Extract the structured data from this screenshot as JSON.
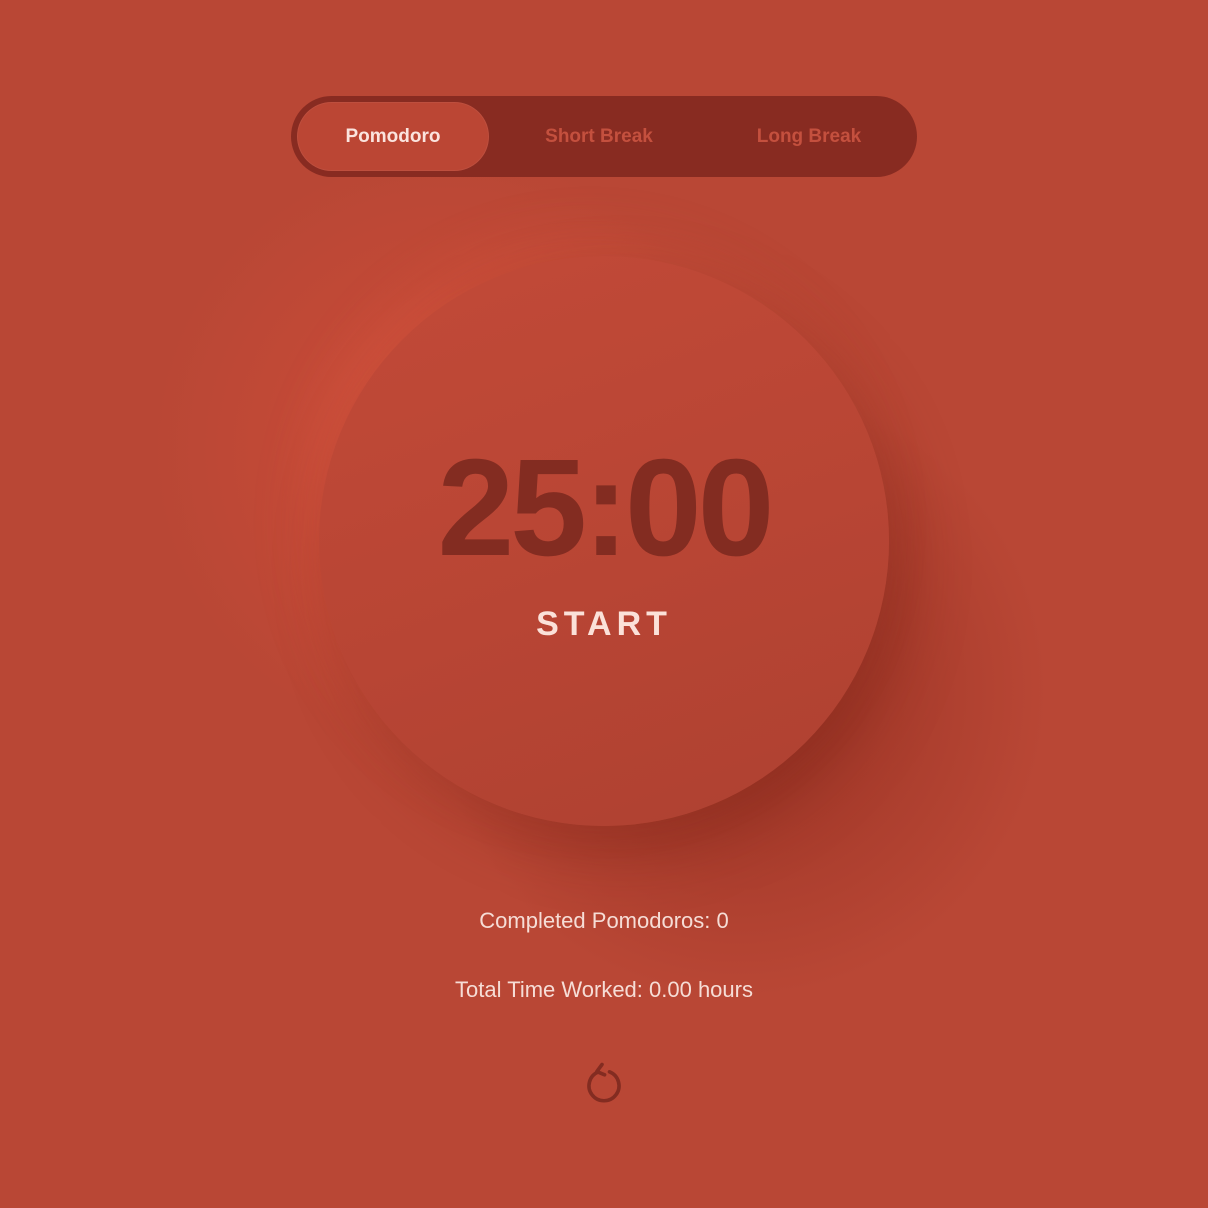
{
  "modes": {
    "pomodoro": "Pomodoro",
    "short_break": "Short Break",
    "long_break": "Long Break",
    "active": "Pomodoro"
  },
  "timer": {
    "display": "25:00",
    "action_label": "START"
  },
  "stats": {
    "completed": "Completed Pomodoros: 0",
    "total_time": "Total Time Worked: 0.00 hours"
  },
  "icons": {
    "reset": "reset-icon"
  },
  "colors": {
    "background": "#b94735",
    "switch_track": "#882b21",
    "active_tab": "#bb4634",
    "timer_text": "#832c21",
    "light_text": "#fbe1d9"
  }
}
